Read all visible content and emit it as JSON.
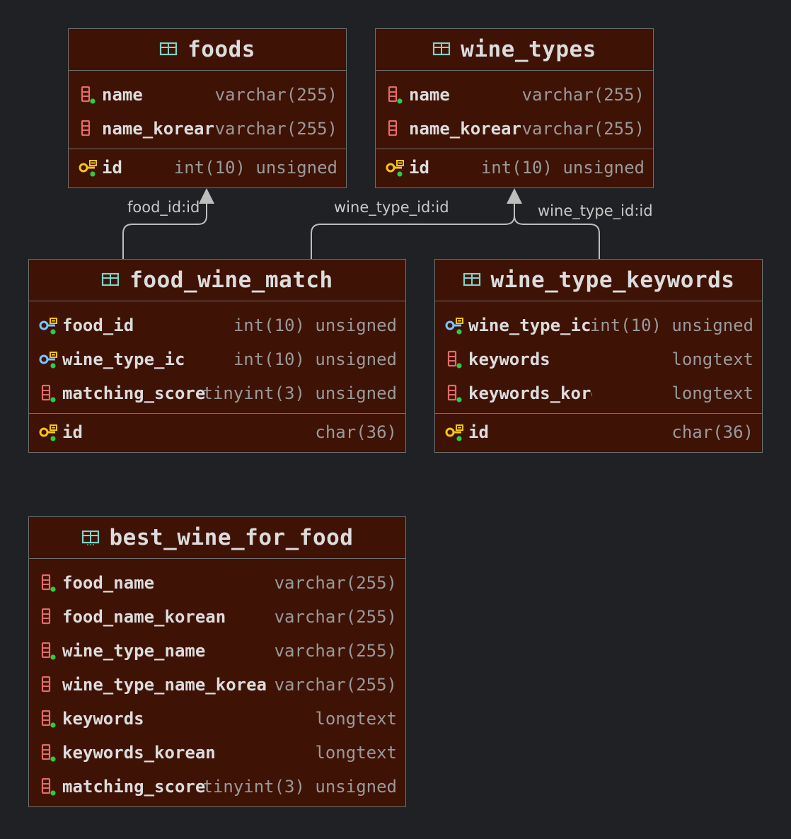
{
  "colors": {
    "background": "#1f2124",
    "entity_fill": "#3f1206",
    "entity_border": "#6f6f6f",
    "title_text": "#dcdcdc",
    "type_text": "#9a9a9a",
    "column_icon": "#e06c6c",
    "primary_key_icon": "#f5c518",
    "foreign_key_icon": "#7cc4ff",
    "not_null_dot": "#2ecc40",
    "table_icon": "#7fd3c7",
    "relation_line": "#bdbdbd"
  },
  "entities": {
    "foods": {
      "title": "foods",
      "icon": "table-icon",
      "columns": [
        {
          "name": "name",
          "type": "varchar(255)",
          "icon": "column-not-null-icon"
        },
        {
          "name": "name_korear",
          "type": "varchar(255)",
          "icon": "column-icon"
        }
      ],
      "keys": [
        {
          "name": "id",
          "type": "int(10) unsigned",
          "icon": "primary-key-icon"
        }
      ]
    },
    "wine_types": {
      "title": "wine_types",
      "icon": "table-icon",
      "columns": [
        {
          "name": "name",
          "type": "varchar(255)",
          "icon": "column-not-null-icon"
        },
        {
          "name": "name_korear",
          "type": "varchar(255)",
          "icon": "column-icon"
        }
      ],
      "keys": [
        {
          "name": "id",
          "type": "int(10) unsigned",
          "icon": "primary-key-icon"
        }
      ]
    },
    "food_wine_match": {
      "title": "food_wine_match",
      "icon": "table-icon",
      "columns": [
        {
          "name": "food_id",
          "type": "int(10) unsigned",
          "icon": "foreign-key-icon"
        },
        {
          "name": "wine_type_ic",
          "type": "int(10) unsigned",
          "icon": "foreign-key-icon"
        },
        {
          "name": "matching_score",
          "type": "tinyint(3) unsigned",
          "icon": "column-not-null-icon"
        }
      ],
      "keys": [
        {
          "name": "id",
          "type": "char(36)",
          "icon": "primary-key-icon"
        }
      ]
    },
    "wine_type_keywords": {
      "title": "wine_type_keywords",
      "icon": "table-icon",
      "columns": [
        {
          "name": "wine_type_ic",
          "type": "int(10) unsigned",
          "icon": "foreign-key-icon"
        },
        {
          "name": "keywords",
          "type": "longtext",
          "icon": "column-not-null-icon"
        },
        {
          "name": "keywords_korear",
          "type": "longtext",
          "icon": "column-not-null-icon"
        }
      ],
      "keys": [
        {
          "name": "id",
          "type": "char(36)",
          "icon": "primary-key-icon"
        }
      ]
    },
    "best_wine_for_food": {
      "title": "best_wine_for_food",
      "icon": "view-icon",
      "columns": [
        {
          "name": "food_name",
          "type": "varchar(255)",
          "icon": "column-not-null-icon"
        },
        {
          "name": "food_name_korean",
          "type": "varchar(255)",
          "icon": "column-icon"
        },
        {
          "name": "wine_type_name",
          "type": "varchar(255)",
          "icon": "column-not-null-icon"
        },
        {
          "name": "wine_type_name_korea",
          "type": "varchar(255)",
          "icon": "column-icon"
        },
        {
          "name": "keywords",
          "type": "longtext",
          "icon": "column-not-null-icon"
        },
        {
          "name": "keywords_korean",
          "type": "longtext",
          "icon": "column-not-null-icon"
        },
        {
          "name": "matching_score",
          "type": "tinyint(3) unsigned",
          "icon": "column-not-null-icon"
        }
      ],
      "keys": []
    }
  },
  "relations": [
    {
      "label": "food_id:id",
      "from": "food_wine_match",
      "to": "foods"
    },
    {
      "label": "wine_type_id:id",
      "from": "food_wine_match",
      "to": "wine_types"
    },
    {
      "label": "wine_type_id:id",
      "from": "wine_type_keywords",
      "to": "wine_types"
    }
  ]
}
